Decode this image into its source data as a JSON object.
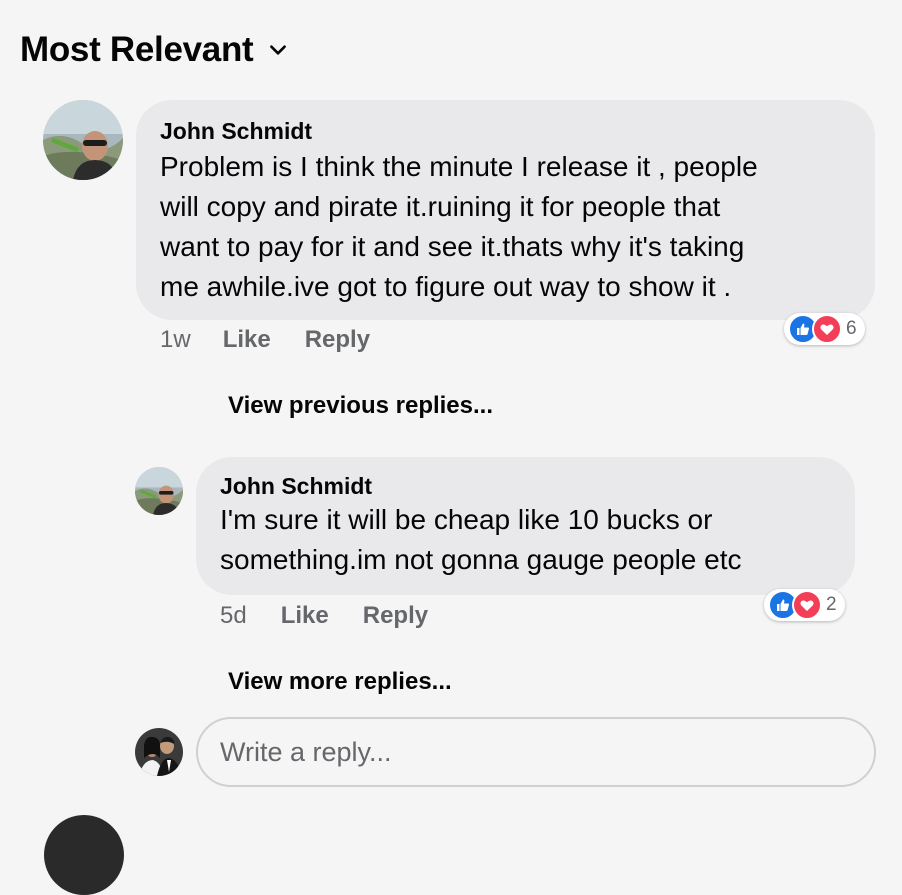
{
  "header": {
    "sort_label": "Most Relevant"
  },
  "comment": {
    "author": "John Schmidt",
    "text": "Problem is I think the minute I release it , people\nwill copy and pirate it.ruining it for people that\nwant to pay for it and see it.thats why it's taking\nme awhile.ive got to figure out way to show it .",
    "time": "1w",
    "like_label": "Like",
    "reply_label": "Reply",
    "reaction_count": "6"
  },
  "view_previous": "View previous replies...",
  "reply": {
    "author": "John Schmidt",
    "text": "I'm sure it will be cheap like 10 bucks or\nsomething.im not gonna gauge people etc",
    "time": "5d",
    "like_label": "Like",
    "reply_label": "Reply",
    "reaction_count": "2"
  },
  "view_more": "View more replies...",
  "composer": {
    "placeholder": "Write a reply..."
  },
  "colors": {
    "bubble": "#e9e9eb",
    "like_blue": "#1b74e4",
    "love_red": "#f33e58",
    "meta_gray": "#65676b"
  },
  "icons": [
    "chevron-down-icon",
    "like-reaction-icon",
    "love-reaction-icon"
  ]
}
